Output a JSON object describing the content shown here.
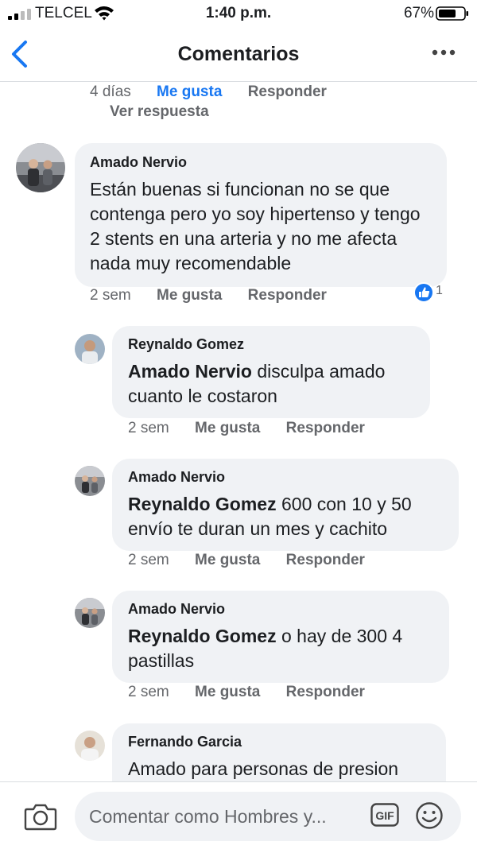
{
  "status_bar": {
    "carrier": "TELCEL",
    "time": "1:40 p.m.",
    "battery": "67%"
  },
  "header": {
    "title": "Comentarios"
  },
  "previous_comment": {
    "time": "4 días",
    "like": "Me gusta",
    "reply": "Responder",
    "view_reply": "Ver respuesta",
    "liked": true
  },
  "comments": [
    {
      "author": "Amado Nervio",
      "mention": "",
      "text": "Están buenas si funcionan  no se que contenga pero yo soy hipertenso y tengo 2 stents en una arteria y no me afecta nada muy recomendable",
      "time": "2 sem",
      "like": "Me gusta",
      "reply": "Responder",
      "reactions": "1"
    },
    {
      "author": "Reynaldo Gomez",
      "mention": "Amado Nervio",
      "text": "disculpa amado cuanto le costaron",
      "time": "2 sem",
      "like": "Me gusta",
      "reply": "Responder"
    },
    {
      "author": "Amado Nervio",
      "mention": "Reynaldo Gomez",
      "text": "600 con 10 y 50 envío te duran un mes y cachito",
      "time": "2 sem",
      "like": "Me gusta",
      "reply": "Responder"
    },
    {
      "author": "Amado Nervio",
      "mention": "Reynaldo Gomez",
      "text": "o hay de 300 4 pastillas",
      "time": "2 sem",
      "like": "Me gusta",
      "reply": "Responder"
    },
    {
      "author": "Fernando Garcia",
      "mention": "",
      "text": "Amado para personas de presion"
    }
  ],
  "composer": {
    "placeholder": "Comentar como Hombres y...",
    "gif_label": "GIF"
  },
  "colors": {
    "accent": "#1877f2",
    "bubble": "#f0f2f5",
    "secondary_text": "#65676b"
  },
  "icons": [
    "signal-icon",
    "wifi-icon",
    "battery-icon",
    "back-chevron-icon",
    "more-icon",
    "like-reaction-icon",
    "camera-icon",
    "gif-icon",
    "emoji-icon"
  ]
}
